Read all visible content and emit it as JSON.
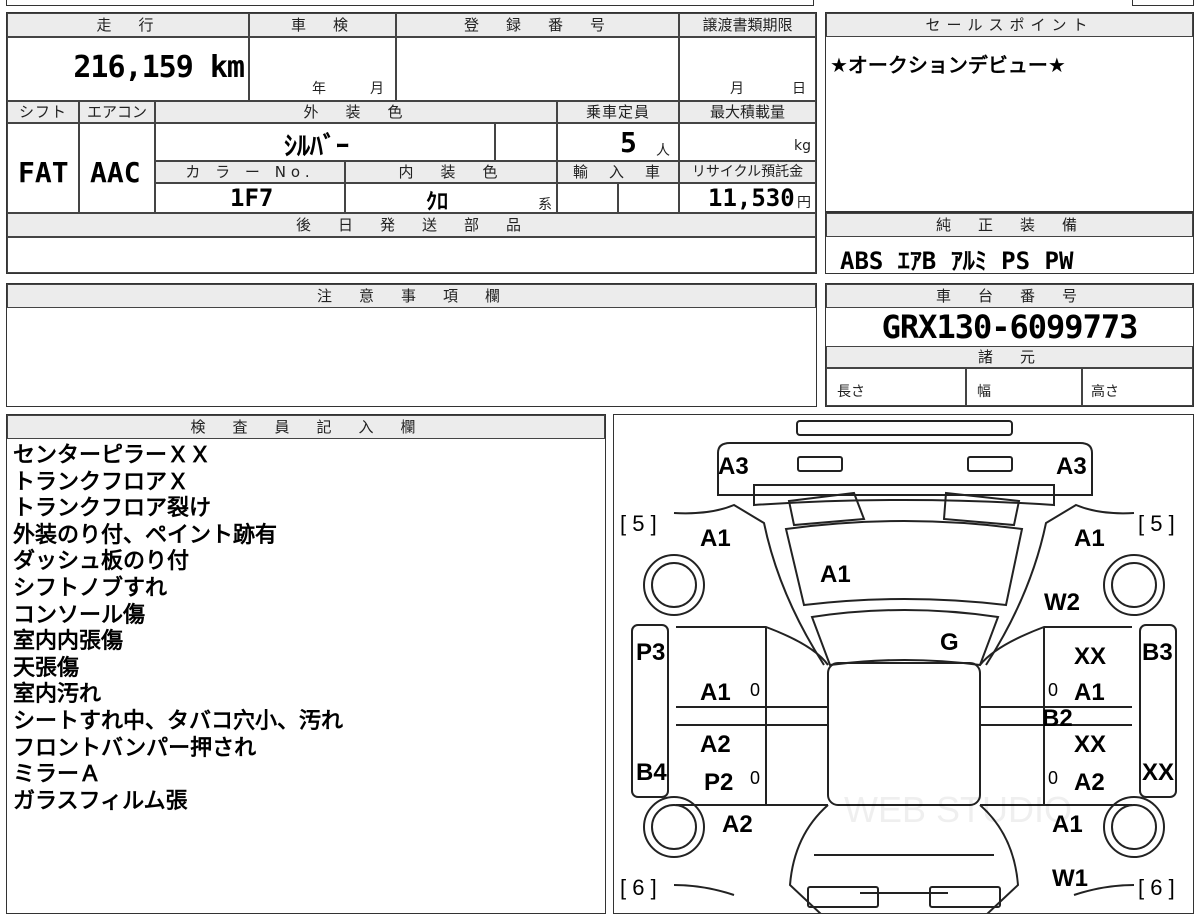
{
  "vehicle": {
    "mileage_header": "走　行",
    "mileage": "216,159 km",
    "shaken_header": "車　検",
    "shaken_year": "年",
    "shaken_month": "月",
    "reg_header": "登　録　番　号",
    "transfer_header": "譲渡書類期限",
    "transfer_month": "月",
    "transfer_day": "日",
    "shift_header": "シフト",
    "shift": "FAT",
    "ac_header": "エアコン",
    "ac": "AAC",
    "exterior_header": "外　装　色",
    "exterior": "ｼﾙﾊﾞｰ",
    "capacity_header": "乗車定員",
    "capacity": "5",
    "capacity_unit": "人",
    "load_header": "最大積載量",
    "load_unit": "kg",
    "color_no_header": "カ ラ ー No.",
    "color_no": "1F7",
    "interior_header": "内　装　色",
    "interior": "ｸﾛ",
    "interior_unit": "系",
    "import_header": "輸　入　車",
    "recycle_header": "リサイクル預託金",
    "recycle": "11,530",
    "recycle_unit": "円",
    "later_parts_header": "後　日　発　送　部　品"
  },
  "sales": {
    "header": "セールスポイント",
    "text": "★オークションデビュー★"
  },
  "equipment": {
    "header": "純　正　装　備",
    "items": "ABS ｴｱB ｱﾙﾐ PS PW"
  },
  "notes": {
    "header": "注　意　事　項　欄"
  },
  "chassis": {
    "header": "車　台　番　号",
    "number": "GRX130-6099773",
    "spec_header": "諸　元",
    "length": "長さ",
    "width": "幅",
    "height": "高さ"
  },
  "inspector": {
    "header": "検　査　員　記　入　欄",
    "lines": [
      "センターピラーＸＸ",
      "トランクフロアＸ",
      "トランクフロア裂け",
      "外装のり付、ペイント跡有",
      "ダッシュ板のり付",
      "シフトノブすれ",
      "コンソール傷",
      "室内内張傷",
      "天張傷",
      "室内汚れ",
      "シートすれ中、タバコ穴小、汚れ",
      "フロントバンパー押され",
      "ミラーＡ",
      "ガラスフィルム張"
    ]
  },
  "diagram": {
    "tire_rear_left": "5",
    "tire_rear_right": "5",
    "tire_front_left": "6",
    "tire_front_right": "6",
    "marks": {
      "a3_left": "A3",
      "a3_right": "A3",
      "a1_rear_left": "A1",
      "a1_rear_right": "A1",
      "a1_roof_glass": "A1",
      "w2": "W2",
      "g": "G",
      "p3": "P3",
      "b3": "B3",
      "xx_right_upper": "XX",
      "a1_left_door": "A1",
      "a1_right_door": "A1",
      "b2": "B2",
      "xx_right_mid": "XX",
      "a2_left_door": "A2",
      "b4": "B4",
      "p2": "P2",
      "a2_right_door": "A2",
      "xx_far_right": "XX",
      "a2_front_left": "A2",
      "a1_front_right": "A1",
      "w1": "W1",
      "zero1": "0",
      "zero2": "0",
      "zero3": "0",
      "zero4": "0"
    },
    "watermark": "WEB STUDIO"
  }
}
